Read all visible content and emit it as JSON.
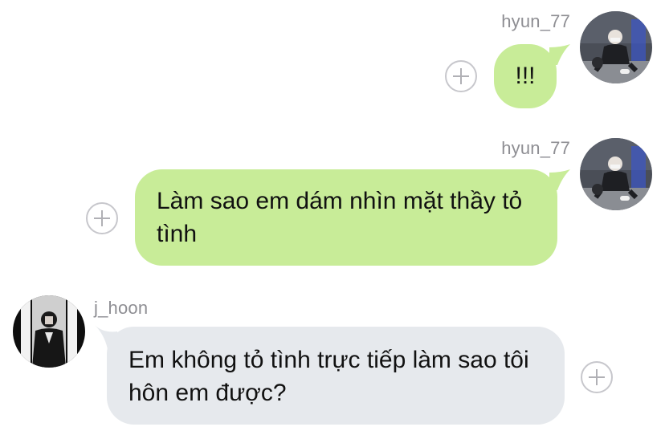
{
  "messages": [
    {
      "sender": "hyun_77",
      "text": "!!!"
    },
    {
      "sender": "hyun_77",
      "text": "Làm sao em dám nhìn mặt thầy tỏ tình"
    },
    {
      "sender": "j_hoon",
      "text": "Em không tỏ tình trực tiếp làm sao tôi hôn em được?"
    }
  ],
  "colors": {
    "outgoing_bubble": "#c8ec98",
    "incoming_bubble": "#e6e9ed",
    "username_text": "#8e8e93",
    "plus_icon": "#c7c7cc"
  },
  "icons": [
    "plus-icon",
    "avatar-photo"
  ]
}
